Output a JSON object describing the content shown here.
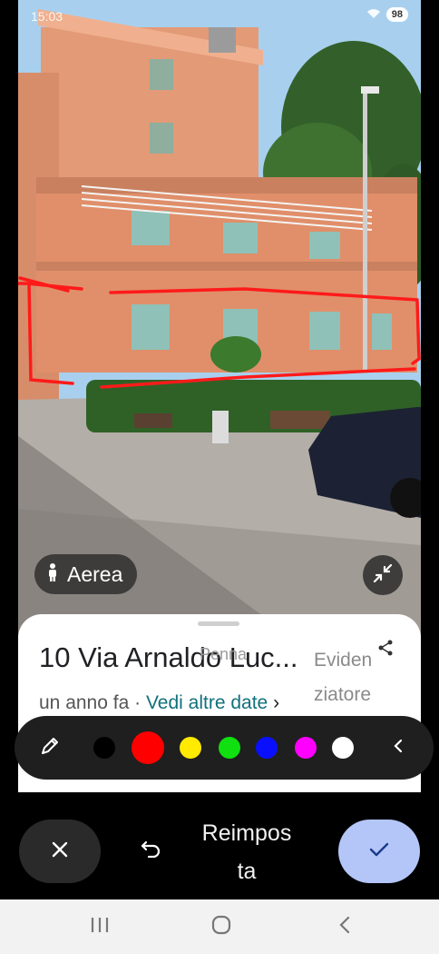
{
  "status_bar": {
    "time": "15:03",
    "battery": "98"
  },
  "street_view": {
    "aerial_chip": {
      "icon": "person-icon",
      "label": "Aerea"
    },
    "collapse_icon": "collapse-icon",
    "annotation": {
      "stroke_color": "#ff1a1a"
    }
  },
  "place_card": {
    "title": "10 Via Arnaldo Luc...",
    "date_text": "un anno fa",
    "separator": "·",
    "more_dates_link": "Vedi altre date",
    "more_dates_chevron": "›",
    "link_color": "#11707c",
    "share_icon": "share-icon"
  },
  "markup_toolbar": {
    "tool_label_1": "Evidenziatore",
    "tool_label_1_line1": "Eviden",
    "tool_label_1_line2": "ziatore",
    "tool_label_2": "Penna",
    "pen_icon": "pen-icon",
    "colors": [
      "#000000",
      "#ff0000",
      "#ffea00",
      "#10e010",
      "#0a10ff",
      "#ff00ff",
      "#ffffff"
    ],
    "selected_color": "#ff0000",
    "collapse_icon": "chevron-left-icon"
  },
  "actions": {
    "cancel_icon": "close-icon",
    "undo_icon": "undo-icon",
    "reset_label_line1": "Reimpos",
    "reset_label_line2": "ta",
    "confirm_icon": "check-icon",
    "confirm_color": "#b4c6f8"
  },
  "nav_bar": {
    "recents_icon": "recents-icon",
    "home_icon": "home-icon",
    "back_icon": "back-icon"
  }
}
